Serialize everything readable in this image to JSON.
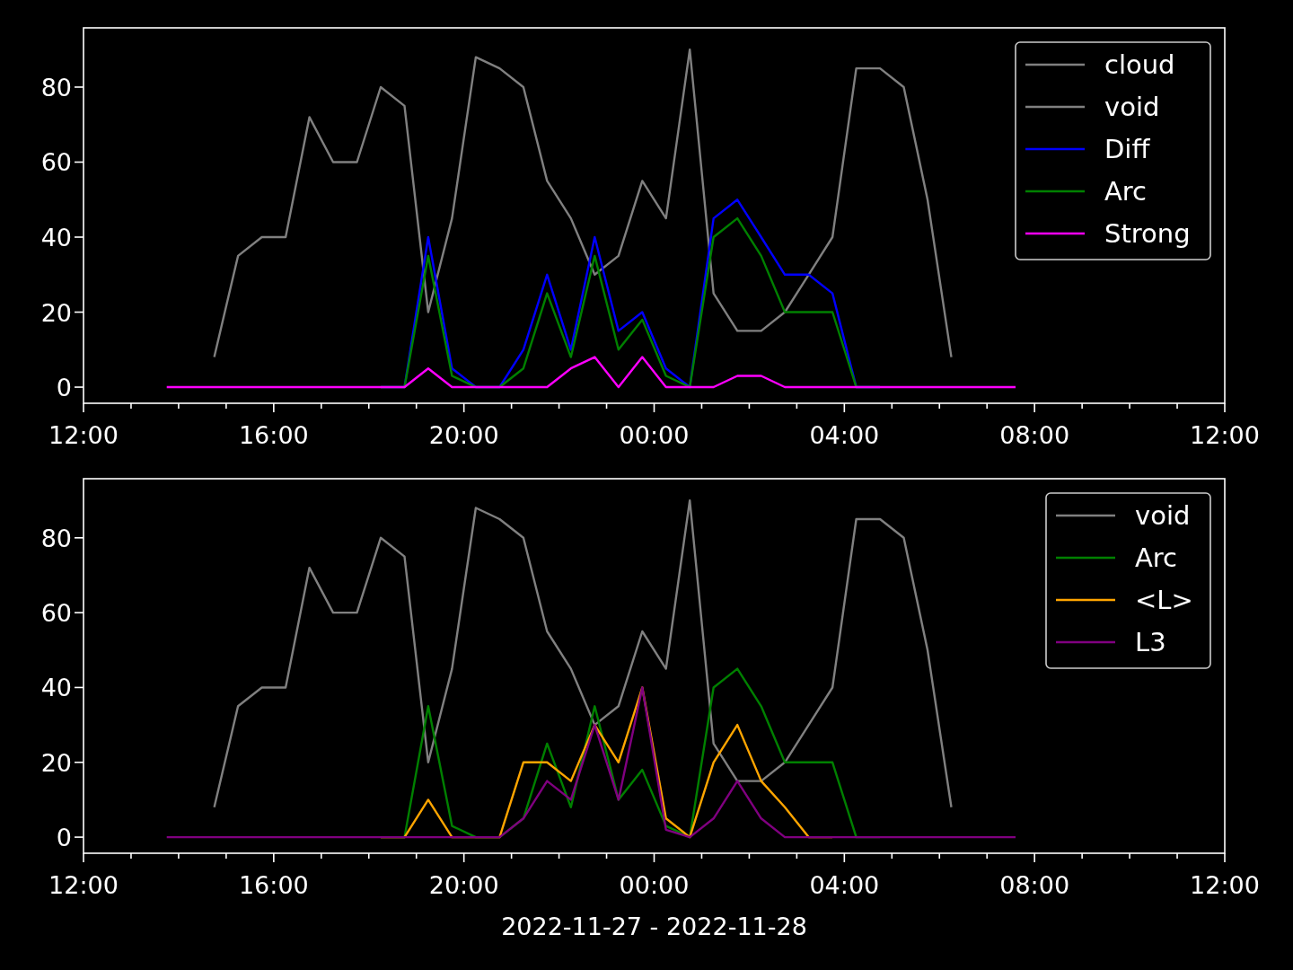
{
  "charts": [
    {
      "chart_data": {
        "type": "line",
        "legend": "upper right",
        "x": [
          "2022-11-27T13:45",
          "2022-11-27T14:15",
          "2022-11-27T14:45",
          "2022-11-27T15:15",
          "2022-11-27T15:45",
          "2022-11-27T16:15",
          "2022-11-27T16:45",
          "2022-11-27T17:15",
          "2022-11-27T17:45",
          "2022-11-27T18:15",
          "2022-11-27T18:45",
          "2022-11-27T19:15",
          "2022-11-27T19:45",
          "2022-11-27T20:15",
          "2022-11-27T20:45",
          "2022-11-27T21:15",
          "2022-11-27T21:45",
          "2022-11-27T22:15",
          "2022-11-27T22:45",
          "2022-11-27T23:15",
          "2022-11-27T23:45",
          "2022-11-28T00:15",
          "2022-11-28T00:45",
          "2022-11-28T01:15",
          "2022-11-28T01:45",
          "2022-11-28T02:15",
          "2022-11-28T02:45",
          "2022-11-28T03:15",
          "2022-11-28T03:45",
          "2022-11-28T04:15",
          "2022-11-28T04:45",
          "2022-11-28T05:15",
          "2022-11-28T05:45",
          "2022-11-28T06:15",
          "2022-11-28T06:45",
          "2022-11-28T07:15",
          "2022-11-28T07:36"
        ],
        "xlim": [
          "2022-11-27T12:00",
          "2022-11-28T12:00"
        ],
        "ylim": [
          -4.3,
          95.8
        ],
        "xticks": [
          {
            "value": "2022-11-27T12:00",
            "label": "12:00"
          },
          {
            "value": "2022-11-27T16:00",
            "label": "16:00"
          },
          {
            "value": "2022-11-27T20:00",
            "label": "20:00"
          },
          {
            "value": "2022-11-28T00:00",
            "label": "00:00"
          },
          {
            "value": "2022-11-28T04:00",
            "label": "04:00"
          },
          {
            "value": "2022-11-28T08:00",
            "label": "08:00"
          },
          {
            "value": "2022-11-28T12:00",
            "label": "12:00"
          }
        ],
        "yticks": [
          0,
          20,
          40,
          60,
          80
        ],
        "series": [
          {
            "name": "cloud",
            "color": "#808080",
            "values": [
              null,
              null,
              null,
              null,
              null,
              null,
              null,
              null,
              null,
              null,
              null,
              null,
              null,
              null,
              null,
              null,
              null,
              null,
              null,
              null,
              null,
              null,
              null,
              null,
              null,
              null,
              null,
              null,
              null,
              null,
              null,
              null,
              null,
              null,
              null,
              null,
              null
            ]
          },
          {
            "name": "void",
            "color": "#808080",
            "values": [
              null,
              null,
              8,
              35,
              40,
              40,
              72,
              60,
              60,
              80,
              75,
              20,
              45,
              88,
              85,
              80,
              55,
              45,
              30,
              35,
              55,
              45,
              90,
              25,
              15,
              15,
              20,
              30,
              40,
              85,
              85,
              80,
              50,
              8,
              null,
              null,
              null
            ]
          },
          {
            "name": "Diff",
            "color": "#0000ff",
            "values": [
              null,
              null,
              null,
              null,
              null,
              null,
              null,
              null,
              null,
              0,
              0,
              40,
              5,
              0,
              0,
              10,
              30,
              10,
              40,
              15,
              20,
              5,
              0,
              45,
              50,
              40,
              30,
              30,
              25,
              0,
              0,
              null,
              null,
              null,
              null,
              null,
              null
            ]
          },
          {
            "name": "Arc",
            "color": "#008000",
            "values": [
              null,
              null,
              null,
              null,
              null,
              null,
              null,
              null,
              null,
              0,
              0,
              35,
              3,
              0,
              0,
              5,
              25,
              8,
              35,
              10,
              18,
              3,
              0,
              40,
              45,
              35,
              20,
              20,
              20,
              0,
              0,
              null,
              null,
              null,
              null,
              null,
              null
            ]
          },
          {
            "name": "Strong",
            "color": "#ff00ff",
            "values": [
              0,
              0,
              0,
              0,
              0,
              0,
              0,
              0,
              0,
              0,
              0,
              5,
              0,
              0,
              0,
              0,
              0,
              5,
              8,
              0,
              8,
              0,
              0,
              0,
              3,
              3,
              0,
              0,
              0,
              0,
              0,
              0,
              0,
              0,
              0,
              0,
              0
            ]
          }
        ]
      }
    },
    {
      "chart_data": {
        "type": "line",
        "legend": "upper right",
        "xlabel": "2022-11-27 - 2022-11-28",
        "x": [
          "2022-11-27T13:45",
          "2022-11-27T14:15",
          "2022-11-27T14:45",
          "2022-11-27T15:15",
          "2022-11-27T15:45",
          "2022-11-27T16:15",
          "2022-11-27T16:45",
          "2022-11-27T17:15",
          "2022-11-27T17:45",
          "2022-11-27T18:15",
          "2022-11-27T18:45",
          "2022-11-27T19:15",
          "2022-11-27T19:45",
          "2022-11-27T20:15",
          "2022-11-27T20:45",
          "2022-11-27T21:15",
          "2022-11-27T21:45",
          "2022-11-27T22:15",
          "2022-11-27T22:45",
          "2022-11-27T23:15",
          "2022-11-27T23:45",
          "2022-11-28T00:15",
          "2022-11-28T00:45",
          "2022-11-28T01:15",
          "2022-11-28T01:45",
          "2022-11-28T02:15",
          "2022-11-28T02:45",
          "2022-11-28T03:15",
          "2022-11-28T03:45",
          "2022-11-28T04:15",
          "2022-11-28T04:45",
          "2022-11-28T05:15",
          "2022-11-28T05:45",
          "2022-11-28T06:15",
          "2022-11-28T06:45",
          "2022-11-28T07:15",
          "2022-11-28T07:36"
        ],
        "xlim": [
          "2022-11-27T12:00",
          "2022-11-28T12:00"
        ],
        "ylim": [
          -4.3,
          95.8
        ],
        "xticks": [
          {
            "value": "2022-11-27T12:00",
            "label": "12:00"
          },
          {
            "value": "2022-11-27T16:00",
            "label": "16:00"
          },
          {
            "value": "2022-11-27T20:00",
            "label": "20:00"
          },
          {
            "value": "2022-11-28T00:00",
            "label": "00:00"
          },
          {
            "value": "2022-11-28T04:00",
            "label": "04:00"
          },
          {
            "value": "2022-11-28T08:00",
            "label": "08:00"
          },
          {
            "value": "2022-11-28T12:00",
            "label": "12:00"
          }
        ],
        "yticks": [
          0,
          20,
          40,
          60,
          80
        ],
        "series": [
          {
            "name": "void",
            "color": "#808080",
            "values": [
              null,
              null,
              8,
              35,
              40,
              40,
              72,
              60,
              60,
              80,
              75,
              20,
              45,
              88,
              85,
              80,
              55,
              45,
              30,
              35,
              55,
              45,
              90,
              25,
              15,
              15,
              20,
              30,
              40,
              85,
              85,
              80,
              50,
              8,
              null,
              null,
              null
            ]
          },
          {
            "name": "Arc",
            "color": "#008000",
            "values": [
              null,
              null,
              null,
              null,
              null,
              null,
              null,
              null,
              null,
              0,
              0,
              35,
              3,
              0,
              0,
              5,
              25,
              8,
              35,
              10,
              18,
              3,
              0,
              40,
              45,
              35,
              20,
              20,
              20,
              0,
              0,
              null,
              null,
              null,
              null,
              null,
              null
            ]
          },
          {
            "name": "<L>",
            "color": "#ffa500",
            "values": [
              null,
              null,
              null,
              null,
              null,
              null,
              null,
              null,
              null,
              0,
              0,
              10,
              0,
              0,
              0,
              20,
              20,
              15,
              30,
              20,
              40,
              5,
              0,
              20,
              30,
              15,
              8,
              0,
              0,
              null,
              null,
              null,
              null,
              null,
              null,
              null,
              null
            ]
          },
          {
            "name": "L3",
            "color": "#800080",
            "values": [
              0,
              0,
              0,
              0,
              0,
              0,
              0,
              0,
              0,
              0,
              0,
              0,
              0,
              0,
              0,
              5,
              15,
              10,
              30,
              10,
              40,
              2,
              0,
              5,
              15,
              5,
              0,
              0,
              0,
              0,
              0,
              0,
              0,
              0,
              0,
              0,
              0
            ]
          }
        ]
      }
    }
  ]
}
